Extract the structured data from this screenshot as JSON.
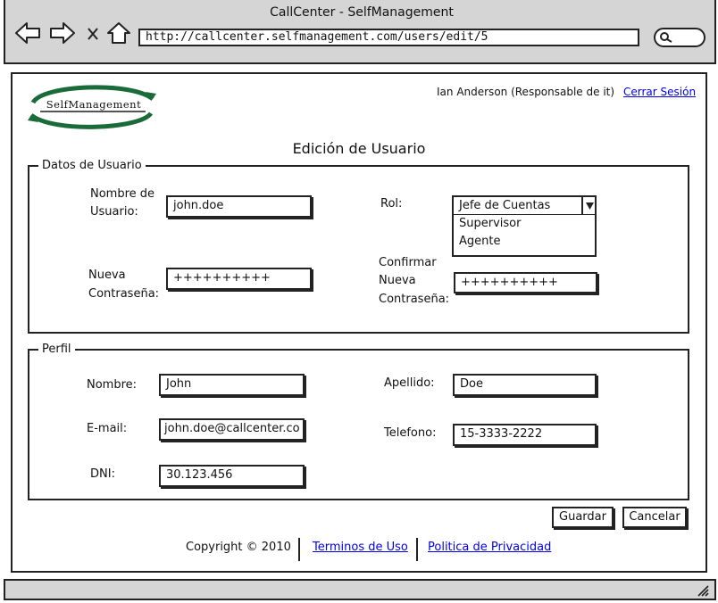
{
  "window": {
    "title": "CallCenter - SelfManagement"
  },
  "browser": {
    "url": "http://callcenter.selfmanagement.com/users/edit/5",
    "icons": [
      "back-arrow-icon",
      "forward-arrow-icon",
      "close-icon",
      "home-icon",
      "search-icon"
    ]
  },
  "header": {
    "logo_text": "SelfManagement",
    "user": "Ian Anderson (Responsable de it)",
    "logout_label": "Cerrar Sesión"
  },
  "page_title": "Edición de Usuario",
  "datos_usuario": {
    "legend": "Datos de Usuario",
    "username_label_1": "Nombre de",
    "username_label_2": "Usuario:",
    "username_value": "john.doe",
    "role_label": "Rol:",
    "role_selected": "Jefe de Cuentas",
    "role_options": [
      "Supervisor",
      "Agente"
    ],
    "password_label_1": "Nueva",
    "password_label_2": "Contraseña:",
    "password_value": "++++++++++",
    "confirm_label_1": "Confirmar",
    "confirm_label_2": "Nueva",
    "confirm_label_3": "Contraseña:",
    "confirm_value": "++++++++++"
  },
  "perfil": {
    "legend": "Perfil",
    "nombre_label": "Nombre:",
    "nombre_value": "John",
    "apellido_label": "Apellido:",
    "apellido_value": "Doe",
    "email_label": "E-mail:",
    "email_value": "john.doe@callcenter.co",
    "telefono_label": "Telefono:",
    "telefono_value": "15-3333-2222",
    "dni_label": "DNI:",
    "dni_value": "30.123.456"
  },
  "actions": {
    "save_label": "Guardar",
    "cancel_label": "Cancelar"
  },
  "footer": {
    "copyright": "Copyright © 2010",
    "terms_label": "Terminos de Uso",
    "privacy_label": "Politica de Privacidad"
  }
}
